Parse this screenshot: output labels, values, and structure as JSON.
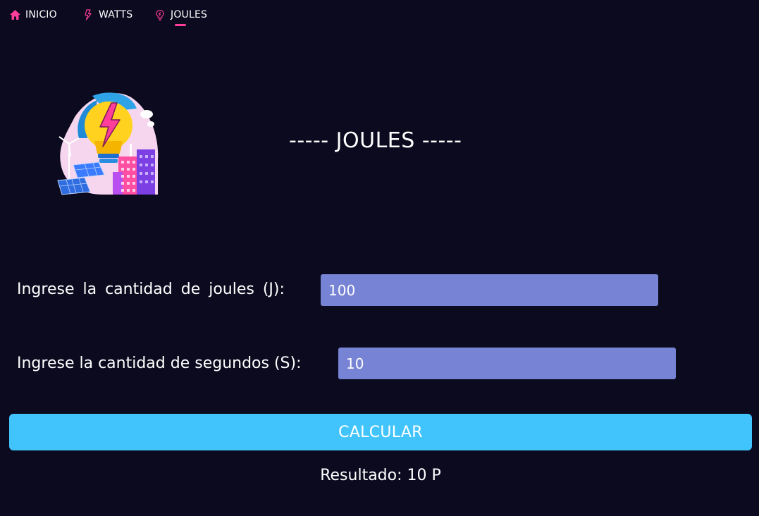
{
  "nav": {
    "items": [
      {
        "label": "INICIO",
        "icon": "home-icon"
      },
      {
        "label": "WATTS",
        "icon": "lightning-icon"
      },
      {
        "label": "JOULES",
        "icon": "lightbulb-icon"
      }
    ],
    "active": "JOULES"
  },
  "colors": {
    "background": "#0b0a1f",
    "accent": "#ff3d9a",
    "input_bg": "#7783d4",
    "button_bg": "#41c4fb"
  },
  "main": {
    "title": "----- JOULES -----",
    "logo_icon": "energy-lightbulb-illustration"
  },
  "form": {
    "joules_label": "Ingrese la cantidad de joules (J):",
    "joules_value": "100",
    "seconds_label": "Ingrese la cantidad de segundos (S):",
    "seconds_value": "10",
    "calculate_label": "CALCULAR"
  },
  "result": {
    "text": "Resultado: 10 P"
  }
}
